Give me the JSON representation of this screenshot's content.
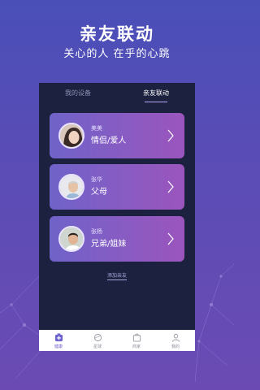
{
  "hero": {
    "title": "亲友联动",
    "subtitle": "关心的人 在乎的心跳"
  },
  "tabs": [
    {
      "label": "我的设备",
      "active": false
    },
    {
      "label": "亲友联动",
      "active": true
    }
  ],
  "contacts": [
    {
      "name": "美美",
      "relation": "情侣/爱人",
      "avatar": "avatar-woman"
    },
    {
      "name": "张华",
      "relation": "父母",
      "avatar": "avatar-older-man"
    },
    {
      "name": "张杨",
      "relation": "兄弟/姐妹",
      "avatar": "avatar-young-man"
    }
  ],
  "add_link": "添加亲友",
  "bottom_nav": [
    {
      "label": "健康",
      "icon": "health-icon",
      "active": true
    },
    {
      "label": "星球",
      "icon": "planet-icon",
      "active": false
    },
    {
      "label": "商家",
      "icon": "shop-icon",
      "active": false
    },
    {
      "label": "我的",
      "icon": "profile-icon",
      "active": false
    }
  ],
  "colors": {
    "accent": "#6e62cf",
    "card_gradient_start": "#6f63c9",
    "card_gradient_end": "#9b55bd",
    "phone_bg": "#1d2140"
  }
}
